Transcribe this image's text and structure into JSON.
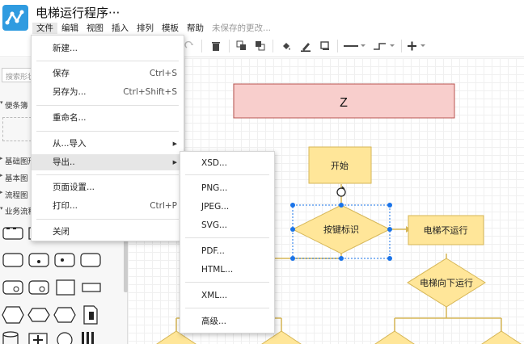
{
  "app": {
    "title": "电梯运行程序···",
    "unsaved_status": "未保存的更改..."
  },
  "menubar": {
    "items": [
      "文件",
      "编辑",
      "视图",
      "插入",
      "排列",
      "模板",
      "帮助"
    ]
  },
  "toolbar": {
    "icons": [
      "undo-icon",
      "delete-icon",
      "to-front-icon",
      "to-back-icon",
      "fill-color-icon",
      "line-color-icon",
      "shadow-icon",
      "line-style-icon",
      "connector-style-icon",
      "insert-icon"
    ]
  },
  "sidebar": {
    "search_placeholder": "搜索形状",
    "sections": [
      "便条簿",
      "基础图形",
      "基本图",
      "流程图",
      "业务流程"
    ]
  },
  "file_menu": {
    "new": "新建...",
    "save": "保存",
    "save_shortcut": "Ctrl+S",
    "save_as": "另存为...",
    "save_as_shortcut": "Ctrl+Shift+S",
    "rename": "重命名...",
    "import_from": "从...导入",
    "export_as": "导出..",
    "page_setup": "页面设置...",
    "print": "打印...",
    "print_shortcut": "Ctrl+P",
    "close": "关闭"
  },
  "export_menu": {
    "items": [
      "XSD...",
      "PNG...",
      "JPEG...",
      "SVG...",
      "PDF...",
      "HTML...",
      "XML...",
      "高级..."
    ]
  },
  "diagram": {
    "title_box": "Z",
    "start": "开始",
    "decision1": "按键标识",
    "stopped": "电梯不运行",
    "decision2": "电梯向下运行"
  },
  "colors": {
    "accent": "#2f9be0",
    "title_fill": "#f8cecc",
    "title_stroke": "#b85450",
    "node_fill": "#ffe699",
    "node_stroke": "#d6b656",
    "selection": "#1a73e8"
  }
}
